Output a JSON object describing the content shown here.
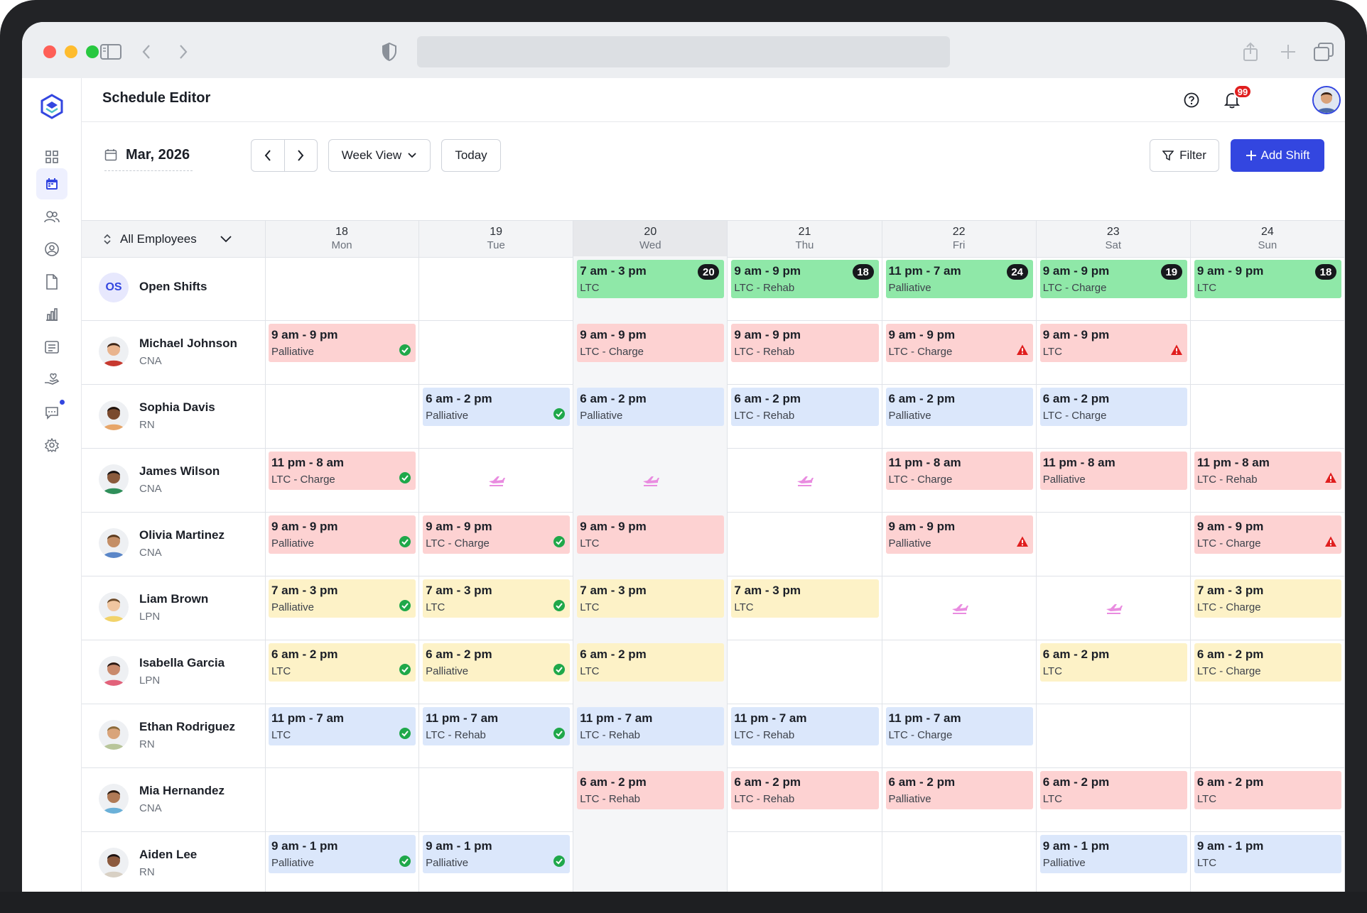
{
  "app": {
    "title": "Schedule Editor",
    "notifications": "99"
  },
  "toolbar": {
    "month": "Mar, 2026",
    "view": "Week View",
    "today": "Today",
    "filter": "Filter",
    "add_shift": "Add Shift"
  },
  "grid": {
    "employee_filter": "All Employees",
    "days": [
      {
        "num": "18",
        "name": "Mon"
      },
      {
        "num": "19",
        "name": "Tue"
      },
      {
        "num": "20",
        "name": "Wed"
      },
      {
        "num": "21",
        "name": "Thu"
      },
      {
        "num": "22",
        "name": "Fri"
      },
      {
        "num": "23",
        "name": "Sat"
      },
      {
        "num": "24",
        "name": "Sun"
      }
    ],
    "today_index": 2,
    "rows": [
      {
        "name": "Open Shifts",
        "role": "",
        "initials": "OS",
        "open": true,
        "cells": [
          null,
          null,
          {
            "time": "7 am - 3 pm",
            "loc": "LTC",
            "color": "green",
            "count": "20"
          },
          {
            "time": "9 am - 9 pm",
            "loc": "LTC - Rehab",
            "color": "green",
            "count": "18"
          },
          {
            "time": "11 pm - 7 am",
            "loc": "Palliative",
            "color": "green",
            "count": "24"
          },
          {
            "time": "9 am - 9 pm",
            "loc": "LTC - Charge",
            "color": "green",
            "count": "19"
          },
          {
            "time": "9 am - 9 pm",
            "loc": "LTC",
            "color": "green",
            "count": "18"
          }
        ]
      },
      {
        "name": "Michael Johnson",
        "role": "CNA",
        "skin": "#e9b48e",
        "hair": "#3b2518",
        "shirt": "#c7392f",
        "cells": [
          {
            "time": "9 am - 9 pm",
            "loc": "Palliative",
            "color": "red",
            "status": "ok"
          },
          null,
          {
            "time": "9 am - 9 pm",
            "loc": "LTC - Charge",
            "color": "red"
          },
          {
            "time": "9 am - 9 pm",
            "loc": "LTC - Rehab",
            "color": "red"
          },
          {
            "time": "9 am - 9 pm",
            "loc": "LTC - Charge",
            "color": "red",
            "status": "warn"
          },
          {
            "time": "9 am - 9 pm",
            "loc": "LTC",
            "color": "red",
            "status": "warn"
          },
          null
        ]
      },
      {
        "name": "Sophia Davis",
        "role": "RN",
        "skin": "#7a4a2e",
        "hair": "#1d120c",
        "shirt": "#e7a66a",
        "cells": [
          null,
          {
            "time": "6 am - 2 pm",
            "loc": "Palliative",
            "color": "blue",
            "status": "ok"
          },
          {
            "time": "6 am - 2 pm",
            "loc": "Palliative",
            "color": "blue"
          },
          {
            "time": "6 am - 2 pm",
            "loc": "LTC - Rehab",
            "color": "blue"
          },
          {
            "time": "6 am - 2 pm",
            "loc": "Palliative",
            "color": "blue"
          },
          {
            "time": "6 am - 2 pm",
            "loc": "LTC - Charge",
            "color": "blue"
          },
          null
        ]
      },
      {
        "name": "James Wilson",
        "role": "CNA",
        "skin": "#8a5a3c",
        "hair": "#151010",
        "shirt": "#2f8f5a",
        "cells": [
          {
            "time": "11 pm - 8 am",
            "loc": "LTC - Charge",
            "color": "red",
            "status": "ok"
          },
          {
            "leave": true
          },
          {
            "leave": true
          },
          {
            "leave": true
          },
          {
            "time": "11 pm - 8 am",
            "loc": "LTC - Charge",
            "color": "red"
          },
          {
            "time": "11 pm - 8 am",
            "loc": "Palliative",
            "color": "red"
          },
          {
            "time": "11 pm - 8 am",
            "loc": "LTC - Rehab",
            "color": "red",
            "status": "warn"
          }
        ]
      },
      {
        "name": "Olivia Martinez",
        "role": "CNA",
        "skin": "#c48e66",
        "hair": "#5a3a1e",
        "shirt": "#5a86c8",
        "cells": [
          {
            "time": "9 am - 9 pm",
            "loc": "Palliative",
            "color": "red",
            "status": "ok"
          },
          {
            "time": "9 am - 9 pm",
            "loc": "LTC - Charge",
            "color": "red",
            "status": "ok"
          },
          {
            "time": "9 am - 9 pm",
            "loc": "LTC",
            "color": "red"
          },
          null,
          {
            "time": "9 am - 9 pm",
            "loc": "Palliative",
            "color": "red",
            "status": "warn"
          },
          null,
          {
            "time": "9 am - 9 pm",
            "loc": "LTC - Charge",
            "color": "red",
            "status": "warn"
          }
        ]
      },
      {
        "name": "Liam Brown",
        "role": "LPN",
        "skin": "#f0c6a0",
        "hair": "#6b4a2a",
        "shirt": "#f2d36a",
        "cells": [
          {
            "time": "7 am - 3 pm",
            "loc": "Palliative",
            "color": "yellow",
            "status": "ok"
          },
          {
            "time": "7 am - 3 pm",
            "loc": "LTC",
            "color": "yellow",
            "status": "ok"
          },
          {
            "time": "7 am - 3 pm",
            "loc": "LTC",
            "color": "yellow"
          },
          {
            "time": "7 am - 3 pm",
            "loc": "LTC",
            "color": "yellow"
          },
          {
            "leave": true
          },
          {
            "leave": true
          },
          {
            "time": "7 am - 3 pm",
            "loc": "LTC - Charge",
            "color": "yellow"
          }
        ]
      },
      {
        "name": "Isabella Garcia",
        "role": "LPN",
        "skin": "#c98a6c",
        "hair": "#2a1812",
        "shirt": "#e2627a",
        "cells": [
          {
            "time": "6 am - 2 pm",
            "loc": "LTC",
            "color": "yellow",
            "status": "ok"
          },
          {
            "time": "6 am - 2 pm",
            "loc": "Palliative",
            "color": "yellow",
            "status": "ok"
          },
          {
            "time": "6 am - 2 pm",
            "loc": "LTC",
            "color": "yellow"
          },
          null,
          null,
          {
            "time": "6 am - 2 pm",
            "loc": "LTC",
            "color": "yellow"
          },
          {
            "time": "6 am - 2 pm",
            "loc": "LTC - Charge",
            "color": "yellow"
          }
        ]
      },
      {
        "name": "Ethan Rodriguez",
        "role": "RN",
        "skin": "#d9a47a",
        "hair": "#8a6a3a",
        "shirt": "#b8c59a",
        "cells": [
          {
            "time": "11 pm - 7 am",
            "loc": "LTC",
            "color": "blue",
            "status": "ok"
          },
          {
            "time": "11 pm - 7 am",
            "loc": "LTC - Rehab",
            "color": "blue",
            "status": "ok"
          },
          {
            "time": "11 pm - 7 am",
            "loc": "LTC - Rehab",
            "color": "blue"
          },
          {
            "time": "11 pm - 7 am",
            "loc": "LTC - Rehab",
            "color": "blue"
          },
          {
            "time": "11 pm - 7 am",
            "loc": "LTC - Charge",
            "color": "blue"
          },
          null,
          null
        ]
      },
      {
        "name": "Mia Hernandez",
        "role": "CNA",
        "skin": "#b07a56",
        "hair": "#2a1a10",
        "shirt": "#6ab0d8",
        "cells": [
          null,
          null,
          {
            "time": "6 am - 2 pm",
            "loc": "LTC - Rehab",
            "color": "red"
          },
          {
            "time": "6 am - 2 pm",
            "loc": "LTC - Rehab",
            "color": "red"
          },
          {
            "time": "6 am - 2 pm",
            "loc": "Palliative",
            "color": "red"
          },
          {
            "time": "6 am - 2 pm",
            "loc": "LTC",
            "color": "red"
          },
          {
            "time": "6 am - 2 pm",
            "loc": "LTC",
            "color": "red"
          }
        ]
      },
      {
        "name": "Aiden Lee",
        "role": "RN",
        "skin": "#8c5a3e",
        "hair": "#1a1212",
        "shirt": "#d8d0c4",
        "cells": [
          {
            "time": "9 am - 1 pm",
            "loc": "Palliative",
            "color": "blue",
            "status": "ok"
          },
          {
            "time": "9 am - 1 pm",
            "loc": "Palliative",
            "color": "blue",
            "status": "ok"
          },
          null,
          null,
          null,
          {
            "time": "9 am - 1 pm",
            "loc": "Palliative",
            "color": "blue"
          },
          {
            "time": "9 am - 1 pm",
            "loc": "LTC",
            "color": "blue"
          }
        ]
      }
    ]
  },
  "colors": {
    "accent": "#3346e0",
    "ok": "#1fa84a",
    "warn": "#e01e1e",
    "leave": "#e98ce0"
  },
  "icons": {
    "sidebar": [
      "logo-icon",
      "dashboard-icon",
      "calendar-icon",
      "users-icon",
      "user-circle-icon",
      "document-icon",
      "bar-chart-icon",
      "list-icon",
      "hand-heart-icon",
      "chat-icon",
      "gear-icon"
    ],
    "leave": "plane-icon",
    "ok": "check-circle-icon",
    "warn": "warning-triangle-icon"
  }
}
